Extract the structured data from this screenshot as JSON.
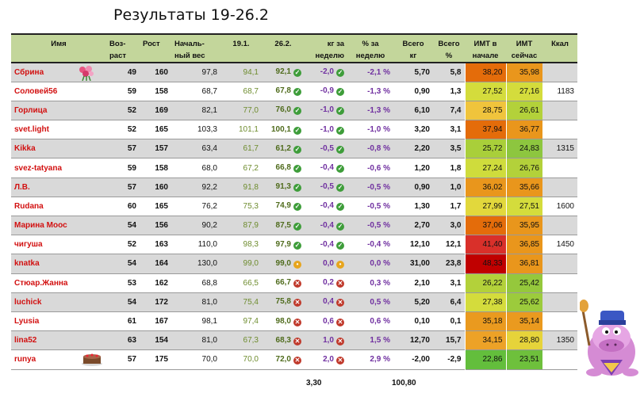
{
  "title": "Результаты 19-26.2",
  "headers": {
    "name": "Имя",
    "age": "Воз-\nраст",
    "height": "Рост",
    "start_weight": "Началь-\nный вес",
    "w1": "19.1.",
    "w2": "26.2.",
    "kg_week": "кг за\nнеделю",
    "pct_week": "% за\nнеделю",
    "total_kg": "Всего\nкг",
    "total_pct": "Всего\n%",
    "bmi_start": "ИМТ в\nначале",
    "bmi_now": "ИМТ\nсейчас",
    "kcal": "Ккал"
  },
  "rows": [
    {
      "name": "Сбрина",
      "age": "49",
      "height": "160",
      "start": "97,8",
      "w1": "94,1",
      "w2": "92,1",
      "kg": "-2,0",
      "pct": "-2,1 %",
      "tkg": "5,70",
      "tpct": "5,8",
      "bmi1": "38,20",
      "bmi2": "35,98",
      "kcal": "",
      "s1": "ok",
      "s2": "ok",
      "bmi1_color": "#e46c0a",
      "bmi2_color": "#e9961c",
      "pic": "flower"
    },
    {
      "name": "Соловей56",
      "age": "59",
      "height": "158",
      "start": "68,7",
      "w1": "68,7",
      "w2": "67,8",
      "kg": "-0,9",
      "pct": "-1,3 %",
      "tkg": "0,90",
      "tpct": "1,3",
      "bmi1": "27,52",
      "bmi2": "27,16",
      "kcal": "1183",
      "s1": "ok",
      "s2": "ok",
      "bmi1_color": "#d4dc3c",
      "bmi2_color": "#d4dc3c"
    },
    {
      "name": "Горлица",
      "age": "52",
      "height": "169",
      "start": "82,1",
      "w1": "77,0",
      "w2": "76,0",
      "kg": "-1,0",
      "pct": "-1,3 %",
      "tkg": "6,10",
      "tpct": "7,4",
      "bmi1": "28,75",
      "bmi2": "26,61",
      "kcal": "",
      "s1": "ok",
      "s2": "ok",
      "bmi1_color": "#f0c43c",
      "bmi2_color": "#b3d13a"
    },
    {
      "name": "svet.light",
      "age": "52",
      "height": "165",
      "start": "103,3",
      "w1": "101,1",
      "w2": "100,1",
      "kg": "-1,0",
      "pct": "-1,0 %",
      "tkg": "3,20",
      "tpct": "3,1",
      "bmi1": "37,94",
      "bmi2": "36,77",
      "kcal": "",
      "s1": "ok",
      "s2": "ok",
      "bmi1_color": "#e46c0a",
      "bmi2_color": "#e9961c"
    },
    {
      "name": "Kikka",
      "age": "57",
      "height": "157",
      "start": "63,4",
      "w1": "61,7",
      "w2": "61,2",
      "kg": "-0,5",
      "pct": "-0,8 %",
      "tkg": "2,20",
      "tpct": "3,5",
      "bmi1": "25,72",
      "bmi2": "24,83",
      "kcal": "1315",
      "s1": "ok",
      "s2": "ok",
      "bmi1_color": "#a9cf3a",
      "bmi2_color": "#8dc63f"
    },
    {
      "name": "svez-tatyana",
      "age": "59",
      "height": "158",
      "start": "68,0",
      "w1": "67,2",
      "w2": "66,8",
      "kg": "-0,4",
      "pct": "-0,6 %",
      "tkg": "1,20",
      "tpct": "1,8",
      "bmi1": "27,24",
      "bmi2": "26,76",
      "kcal": "",
      "s1": "ok",
      "s2": "ok",
      "bmi1_color": "#cfdc3c",
      "bmi2_color": "#b3d13a"
    },
    {
      "name": "Л.В.",
      "age": "57",
      "height": "160",
      "start": "92,2",
      "w1": "91,8",
      "w2": "91,3",
      "kg": "-0,5",
      "pct": "-0,5 %",
      "tkg": "0,90",
      "tpct": "1,0",
      "bmi1": "36,02",
      "bmi2": "35,66",
      "kcal": "",
      "s1": "ok",
      "s2": "ok",
      "bmi1_color": "#e9961c",
      "bmi2_color": "#e9961c"
    },
    {
      "name": "Rudana",
      "age": "60",
      "height": "165",
      "start": "76,2",
      "w1": "75,3",
      "w2": "74,9",
      "kg": "-0,4",
      "pct": "-0,5 %",
      "tkg": "1,30",
      "tpct": "1,7",
      "bmi1": "27,99",
      "bmi2": "27,51",
      "kcal": "1600",
      "s1": "ok",
      "s2": "ok",
      "bmi1_color": "#e2d83c",
      "bmi2_color": "#d4dc3c"
    },
    {
      "name": "Марина Моос",
      "age": "54",
      "height": "156",
      "start": "90,2",
      "w1": "87,9",
      "w2": "87,5",
      "kg": "-0,4",
      "pct": "-0,5 %",
      "tkg": "2,70",
      "tpct": "3,0",
      "bmi1": "37,06",
      "bmi2": "35,95",
      "kcal": "",
      "s1": "ok",
      "s2": "ok",
      "bmi1_color": "#e46c0a",
      "bmi2_color": "#e9961c"
    },
    {
      "name": "чигуша",
      "age": "52",
      "height": "163",
      "start": "110,0",
      "w1": "98,3",
      "w2": "97,9",
      "kg": "-0,4",
      "pct": "-0,4 %",
      "tkg": "12,10",
      "tpct": "12,1",
      "bmi1": "41,40",
      "bmi2": "36,85",
      "kcal": "1450",
      "s1": "ok",
      "s2": "ok",
      "bmi1_color": "#d9302a",
      "bmi2_color": "#e9961c"
    },
    {
      "name": "knatka",
      "age": "54",
      "height": "164",
      "start": "130,0",
      "w1": "99,0",
      "w2": "99,0",
      "kg": "0,0",
      "pct": "0,0 %",
      "tkg": "31,00",
      "tpct": "23,8",
      "bmi1": "48,33",
      "bmi2": "36,81",
      "kcal": "",
      "s1": "eq",
      "s2": "eq",
      "bmi1_color": "#c00000",
      "bmi2_color": "#e9961c"
    },
    {
      "name": "Стюар.Жанна",
      "age": "53",
      "height": "162",
      "start": "68,8",
      "w1": "66,5",
      "w2": "66,7",
      "kg": "0,2",
      "pct": "0,3 %",
      "tkg": "2,10",
      "tpct": "3,1",
      "bmi1": "26,22",
      "bmi2": "25,42",
      "kcal": "",
      "s1": "bad",
      "s2": "bad",
      "bmi1_color": "#b3d13a",
      "bmi2_color": "#95c83c"
    },
    {
      "name": "luchick",
      "age": "54",
      "height": "172",
      "start": "81,0",
      "w1": "75,4",
      "w2": "75,8",
      "kg": "0,4",
      "pct": "0,5 %",
      "tkg": "5,20",
      "tpct": "6,4",
      "bmi1": "27,38",
      "bmi2": "25,62",
      "kcal": "",
      "s1": "bad",
      "s2": "bad",
      "bmi1_color": "#d4dc3c",
      "bmi2_color": "#9ccb3c"
    },
    {
      "name": "Lyusia",
      "age": "61",
      "height": "167",
      "start": "98,1",
      "w1": "97,4",
      "w2": "98,0",
      "kg": "0,6",
      "pct": "0,6 %",
      "tkg": "0,10",
      "tpct": "0,1",
      "bmi1": "35,18",
      "bmi2": "35,14",
      "kcal": "",
      "s1": "bad",
      "s2": "bad",
      "bmi1_color": "#ea9a1f",
      "bmi2_color": "#ea9a1f"
    },
    {
      "name": "lina52",
      "age": "63",
      "height": "154",
      "start": "81,0",
      "w1": "67,3",
      "w2": "68,3",
      "kg": "1,0",
      "pct": "1,5 %",
      "tkg": "12,70",
      "tpct": "15,7",
      "bmi1": "34,15",
      "bmi2": "28,80",
      "kcal": "1350",
      "s1": "bad",
      "s2": "bad",
      "bmi1_color": "#eda227",
      "bmi2_color": "#e6d33a"
    },
    {
      "name": "runya",
      "age": "57",
      "height": "175",
      "start": "70,0",
      "w1": "70,0",
      "w2": "72,0",
      "kg": "2,0",
      "pct": "2,9 %",
      "tkg": "-2,00",
      "tpct": "-2,9",
      "bmi1": "22,86",
      "bmi2": "23,51",
      "kcal": "",
      "s1": "bad",
      "s2": "bad",
      "bmi1_color": "#63be3c",
      "bmi2_color": "#6ec03c",
      "pic": "cake"
    }
  ],
  "totals": {
    "kg_week": "3,30",
    "total_kg": "100,80"
  },
  "colors": {
    "header_bg": "#c3d69b",
    "name_red": "#d21010",
    "purple": "#7030a0",
    "green_ok": "#3e9d3a",
    "red_bad": "#c0392b"
  }
}
